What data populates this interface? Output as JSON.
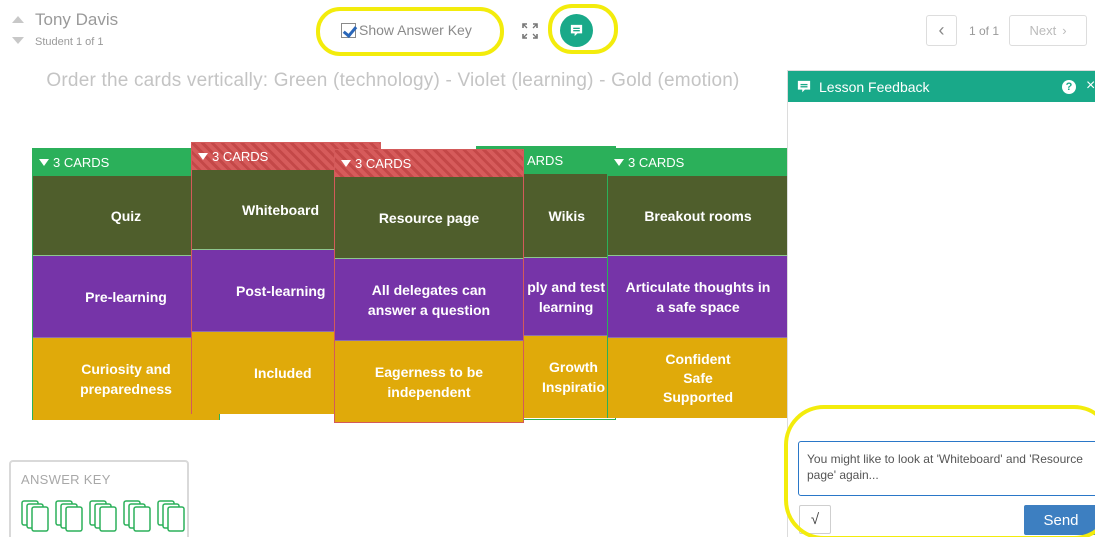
{
  "student": {
    "name": "Tony Davis",
    "position": "Student 1 of 1"
  },
  "toolbar": {
    "show_answer_key_label": "Show Answer Key",
    "show_answer_key_checked": true
  },
  "pager": {
    "count": "1 of 1",
    "next_label": "Next"
  },
  "instruction": "Order the cards vertically: Green (technology) - Violet (learning) - Gold (emotion)",
  "columns": [
    {
      "header": "3 CARDS",
      "color": "green",
      "cards": [
        "Quiz",
        "Pre-learning",
        "Curiosity and\npreparedness"
      ]
    },
    {
      "header": "3 CARDS",
      "color": "red",
      "cards": [
        "Whiteboard",
        "Post-learning",
        "Included"
      ]
    },
    {
      "header": "ARDS",
      "color": "green",
      "cards": [
        "Wikis",
        "ply and test\nlearning",
        "Growth\nInspiratio"
      ]
    },
    {
      "header": "3 CARDS",
      "color": "red",
      "cards": [
        "Resource page",
        "All delegates can\nanswer a question",
        "Eagerness to be\nindependent"
      ]
    },
    {
      "header": "3 CARDS",
      "color": "green",
      "cards": [
        "Breakout rooms",
        "Articulate thoughts in\na safe space",
        "Confident\nSafe\nSupported"
      ]
    }
  ],
  "feedback_panel": {
    "title": "Lesson Feedback",
    "message": "You might like to look at 'Whiteboard' and 'Resource page' again...",
    "sqrt_label": "√",
    "send_label": "Send"
  },
  "answer_key": {
    "label": "ANSWER KEY"
  },
  "colors": {
    "accent_teal": "#19a989",
    "tech": "#4f5e2c",
    "learning": "#7634a8",
    "emotion": "#e0aa0a",
    "highlight": "#f3ec0c",
    "send_blue": "#3d7fc1"
  },
  "icons": [
    "chevron-up-icon",
    "chevron-down-icon",
    "checkbox-icon",
    "fullscreen-icon",
    "feedback-comment-icon",
    "chevron-left-icon",
    "chevron-right-icon",
    "triangle-down-icon",
    "help-icon",
    "close-icon",
    "card-stack-icon"
  ]
}
